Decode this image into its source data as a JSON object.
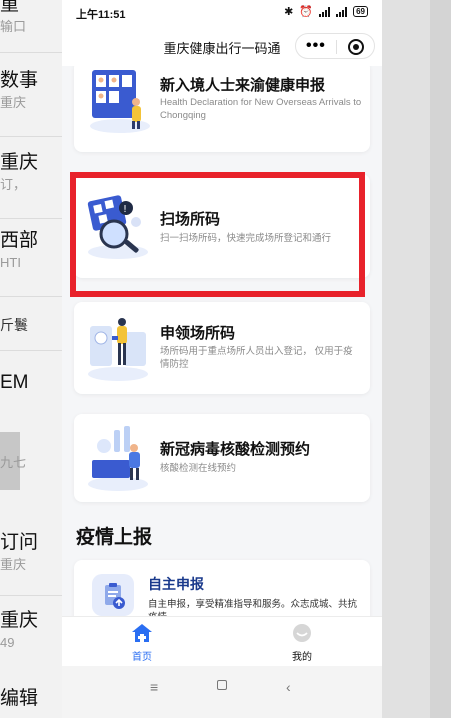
{
  "status": {
    "time": "上午11:51",
    "battery": "69"
  },
  "nav": {
    "title": "重庆健康出行一码通"
  },
  "cards": [
    {
      "title": "新入境人士来渝健康申报",
      "desc": "Health Declaration for New Overseas Arrivals to Chongqing"
    },
    {
      "title": "扫场所码",
      "desc": "扫一扫场所码，快速完成场所登记和通行"
    },
    {
      "title": "申领场所码",
      "desc": "场所码用于重点场所人员出入登记， 仅用于疫情防控"
    },
    {
      "title": "新冠病毒核酸检测预约",
      "desc": "核酸检测在线预约"
    }
  ],
  "section": {
    "title": "疫情上报"
  },
  "report": {
    "title": "自主申报",
    "desc": "自主申报，享受精准指导和服务。众志成城、共抗疫情"
  },
  "tabs": {
    "home": "首页",
    "mine": "我的"
  },
  "bg": {
    "r1t": "重",
    "r1s": "输口",
    "r2t": "数事",
    "r2s": "重庆",
    "r3t": "重庆",
    "r3s": "订，",
    "r4t": "西部",
    "r4s": "HTI",
    "r5t": "斤鬟",
    "r6t": "EM",
    "r7s": "九七",
    "r8t": "订问",
    "r8s": "重庆",
    "r9t": "重庆",
    "r9s": "49",
    "r10t": "编辑"
  },
  "colors": {
    "accent": "#2a6ef2",
    "highlight": "#e8222b",
    "title": "#111111"
  }
}
